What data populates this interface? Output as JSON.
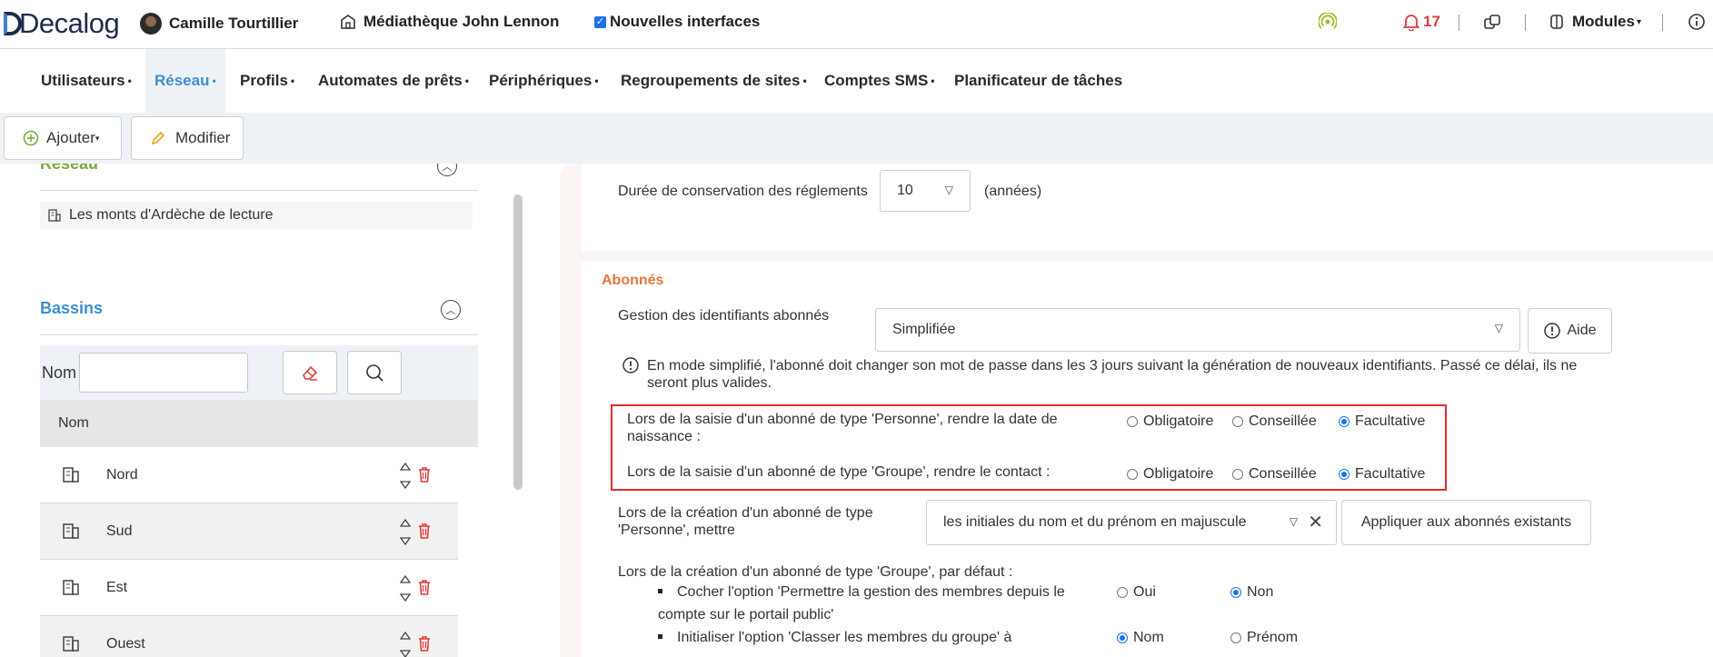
{
  "topbar": {
    "logo": "Decalog",
    "user_name": "Camille Tourtillier",
    "library": "Médiathèque John Lennon",
    "new_interfaces_label": "Nouvelles interfaces",
    "notification_count": "17",
    "modules_label": "Modules",
    "colors": {
      "accent": "#3b8fd0",
      "alert": "#e23a3a",
      "highlight": "#e02d2d",
      "section_orange": "#e8743b",
      "section_green": "#7ea83c"
    }
  },
  "nav": {
    "tabs": [
      {
        "label": "Utilisateurs",
        "dot": "•"
      },
      {
        "label": "Réseau",
        "dot": "•"
      },
      {
        "label": "Profils",
        "dot": "•"
      },
      {
        "label": "Automates de prêts",
        "dot": "•"
      },
      {
        "label": "Périphériques",
        "dot": "•"
      },
      {
        "label": "Regroupements de sites",
        "dot": "•"
      },
      {
        "label": "Comptes SMS",
        "dot": "•"
      },
      {
        "label": "Planificateur de tâches",
        "dot": ""
      }
    ]
  },
  "toolbar": {
    "add_label": "Ajouter",
    "edit_label": "Modifier"
  },
  "left": {
    "reseau_title": "Réseau",
    "reseau_item": "Les monts d'Ardèche de lecture",
    "bassins_title": "Bassins",
    "filter_label": "Nom",
    "filter_value": "",
    "table_header": "Nom",
    "rows": [
      "Nord",
      "Sud",
      "Est",
      "Ouest"
    ]
  },
  "right": {
    "retention_label": "Durée de conservation des réglements",
    "retention_value": "10",
    "retention_unit": "(années)",
    "abonnes_title": "Abonnés",
    "id_management_label": "Gestion des identifiants abonnés",
    "id_management_value": "Simplifiée",
    "help_label": "Aide",
    "info_text_1": "En mode simplifié, l'abonné doit changer son mot de passe dans les 3 jours suivant la génération de nouveaux identifiants. Passé ce délai, ils ne",
    "info_text_2": "seront plus valides.",
    "person_birth_label_1": "Lors de la saisie d'un abonné de type 'Personne', rendre la date de",
    "person_birth_label_2": "naissance :",
    "group_contact_label": "Lors de la saisie d'un abonné de type 'Groupe', rendre le contact :",
    "opt_mandatory": "Obligatoire",
    "opt_advised": "Conseillée",
    "opt_optional": "Facultative",
    "person_creation_label_1": "Lors de la création d'un abonné de type",
    "person_creation_label_2": "'Personne', mettre",
    "person_creation_value": "les initiales du nom et du prénom en majuscule",
    "apply_existing_label": "Appliquer aux abonnés existants",
    "group_creation_label": "Lors de la création d'un abonné de type 'Groupe', par défaut :",
    "bullet1_line1": "Cocher l'option 'Permettre la gestion des membres depuis le",
    "bullet1_line2": "compte sur le portail public'",
    "bullet2_line1": "Initialiser l'option 'Classer les membres du groupe' à",
    "opt_yes": "Oui",
    "opt_no": "Non",
    "opt_lastname": "Nom",
    "opt_firstname": "Prénom"
  }
}
